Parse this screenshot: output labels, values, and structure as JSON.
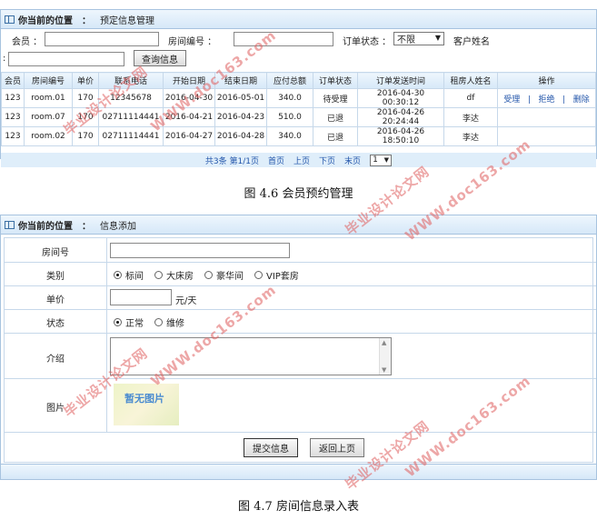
{
  "panel1": {
    "location_label": "你当前的位置",
    "colon": "：",
    "location_value": "预定信息管理",
    "search": {
      "member_label": "会员 ：",
      "room_label": "房间编号 ：",
      "status_label": "订单状态 ：",
      "status_value": "不限",
      "tenant_label": "客户姓名",
      "query_button": "查询信息",
      "colon_left": ":"
    },
    "columns": [
      "会员",
      "房间编号",
      "单价",
      "联系电话",
      "开始日期",
      "结束日期",
      "应付总额",
      "订单状态",
      "订单发送时间",
      "租房人姓名",
      "操作"
    ],
    "rows": [
      {
        "member": "123",
        "room": "room.01",
        "price": "170",
        "phone": "12345678",
        "start": "2016-04-30",
        "end": "2016-05-01",
        "total": "340.0",
        "status": "待受理",
        "sent": "2016-04-30 00:30:12",
        "name": "df",
        "ops": [
          "受理",
          "拒绝",
          "删除"
        ]
      },
      {
        "member": "123",
        "room": "room.07",
        "price": "170",
        "phone": "02711114441",
        "start": "2016-04-21",
        "end": "2016-04-23",
        "total": "510.0",
        "status": "已退",
        "sent": "2016-04-26 20:24:44",
        "name": "李达",
        "ops": []
      },
      {
        "member": "123",
        "room": "room.02",
        "price": "170",
        "phone": "02711114441",
        "start": "2016-04-27",
        "end": "2016-04-28",
        "total": "340.0",
        "status": "已退",
        "sent": "2016-04-26 18:50:10",
        "name": "李达",
        "ops": []
      }
    ],
    "op_sep": "|",
    "pager": {
      "summary": "共3条 第1/1页",
      "first": "首页",
      "prev": "上页",
      "next": "下页",
      "last": "末页",
      "page": "1"
    }
  },
  "caption1": "图 4.6  会员预约管理",
  "panel2": {
    "location_label": "你当前的位置",
    "colon": "：",
    "location_value": "信息添加",
    "fields": {
      "room_no": "房间号",
      "category": "类别",
      "category_options": [
        "标间",
        "大床房",
        "豪华间",
        "VIP套房"
      ],
      "price": "单价",
      "price_unit": "元/天",
      "status": "状态",
      "status_options": [
        "正常",
        "维修"
      ],
      "intro": "介绍",
      "image": "图片",
      "no_image": "暂无图片"
    },
    "submit_button": "提交信息",
    "back_button": "返回上页"
  },
  "caption2": "图 4.7  房间信息录入表",
  "watermark": {
    "line1": "毕业设计论文网",
    "line2": "WWW.doc163.com"
  }
}
